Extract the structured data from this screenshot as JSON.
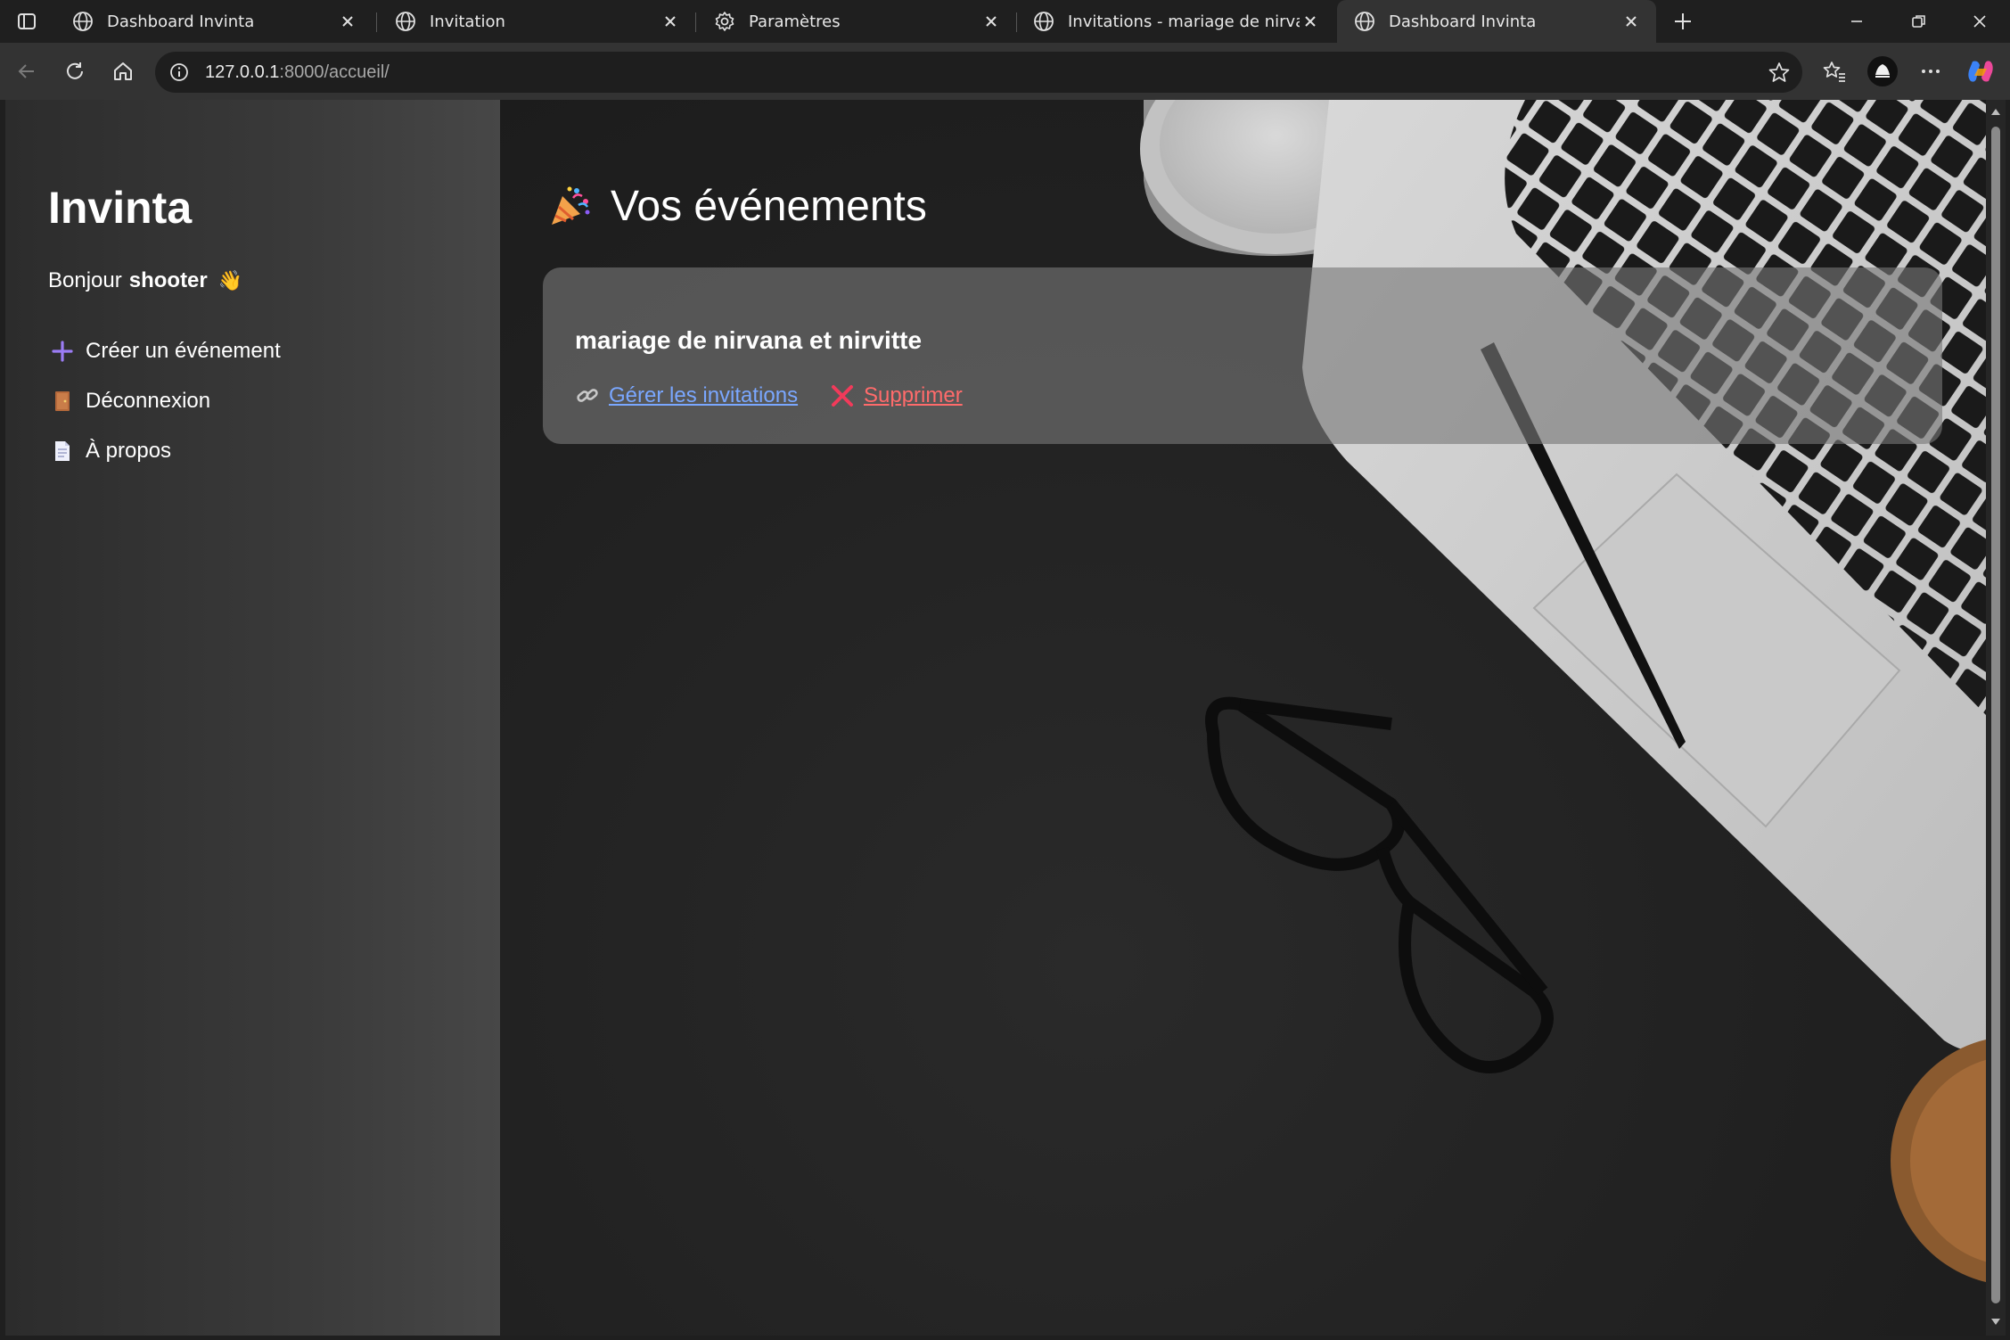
{
  "browser": {
    "tabs": [
      {
        "title": "Dashboard Invinta",
        "icon": "globe-icon",
        "active": false
      },
      {
        "title": "Invitation",
        "icon": "globe-icon",
        "active": false
      },
      {
        "title": "Paramètres",
        "icon": "gear-icon",
        "active": false
      },
      {
        "title": "Invitations - mariage de nirvana e",
        "icon": "globe-icon",
        "active": false
      },
      {
        "title": "Dashboard Invinta",
        "icon": "globe-icon",
        "active": true
      }
    ],
    "url_host": "127.0.0.1",
    "url_rest": ":8000/accueil/"
  },
  "sidebar": {
    "brand": "Invinta",
    "greeting_prefix": "Bonjour",
    "username": "shooter",
    "greeting_emoji": "👋",
    "nav": [
      {
        "label": "Créer un événement",
        "icon": "plus-icon"
      },
      {
        "label": "Déconnexion",
        "icon": "door-icon"
      },
      {
        "label": "À propos",
        "icon": "document-icon"
      }
    ]
  },
  "main": {
    "title": "Vos événements",
    "title_icon": "party-popper-icon",
    "events": [
      {
        "name": "mariage de nirvana et nirvitte",
        "manage_label": "Gérer les invitations",
        "delete_label": "Supprimer"
      }
    ]
  },
  "colors": {
    "link": "#7aa7ff",
    "danger": "#ff6b6b",
    "accent_plus": "#9b7cf5"
  }
}
